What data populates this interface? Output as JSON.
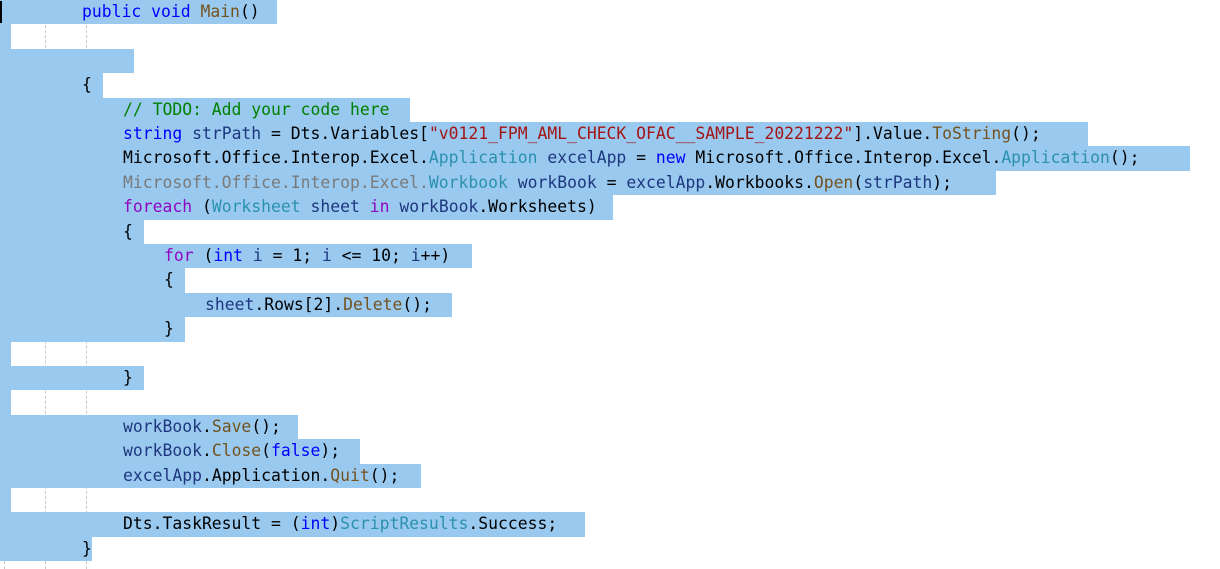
{
  "editor": {
    "language": "C#",
    "selection_color": "#99c9ef",
    "lines": [
      {
        "indent": 2,
        "sel_end_chars": 20,
        "tokens": [
          [
            "kw",
            "public"
          ],
          [
            "pl",
            " "
          ],
          [
            "kw",
            "void"
          ],
          [
            "pl",
            " "
          ],
          [
            "mt",
            "Main"
          ],
          [
            "pl",
            "()"
          ]
        ]
      },
      {
        "indent": 0,
        "sel_end_chars": 1,
        "tokens": []
      },
      {
        "indent": 0,
        "sel_end_chars": 13,
        "tokens": []
      },
      {
        "indent": 2,
        "sel_end_chars": 10,
        "tokens": [
          [
            "pl",
            "{"
          ]
        ]
      },
      {
        "indent": 3,
        "sel_end_chars": 40,
        "tokens": [
          [
            "cm",
            "// TODO: Add your code here"
          ]
        ]
      },
      {
        "indent": 3,
        "sel_end_chars": 106,
        "tokens": [
          [
            "kw",
            "string"
          ],
          [
            "pl",
            " "
          ],
          [
            "lv",
            "strPath"
          ],
          [
            "pl",
            " = Dts.Variables["
          ],
          [
            "st",
            "\"v0121_FPM_AML_CHECK_OFAC__SAMPLE_20221222\""
          ],
          [
            "pl",
            "].Value."
          ],
          [
            "mt",
            "ToString"
          ],
          [
            "pl",
            "();"
          ]
        ]
      },
      {
        "indent": 3,
        "sel_end_chars": 116,
        "tokens": [
          [
            "pl",
            "Microsoft.Office.Interop.Excel."
          ],
          [
            "ty",
            "Application"
          ],
          [
            "pl",
            " "
          ],
          [
            "lv",
            "excelApp"
          ],
          [
            "pl",
            " = "
          ],
          [
            "kw",
            "new"
          ],
          [
            "pl",
            " Microsoft.Office.Interop.Excel."
          ],
          [
            "ty",
            "Application"
          ],
          [
            "pl",
            "();"
          ]
        ]
      },
      {
        "indent": 3,
        "sel_end_chars": 97,
        "tokens": [
          [
            "gr",
            "Microsoft.Office.Interop.Excel."
          ],
          [
            "ty",
            "Workbook"
          ],
          [
            "pl",
            " "
          ],
          [
            "lv",
            "workBook"
          ],
          [
            "pl",
            " = "
          ],
          [
            "lv",
            "excelApp"
          ],
          [
            "pl",
            ".Workbooks."
          ],
          [
            "mt",
            "Open"
          ],
          [
            "pl",
            "("
          ],
          [
            "lv",
            "strPath"
          ],
          [
            "pl",
            ");"
          ]
        ]
      },
      {
        "indent": 3,
        "sel_end_chars": 60,
        "tokens": [
          [
            "ctl",
            "foreach"
          ],
          [
            "pl",
            " ("
          ],
          [
            "ty",
            "Worksheet"
          ],
          [
            "pl",
            " "
          ],
          [
            "lv",
            "sheet"
          ],
          [
            "pl",
            " "
          ],
          [
            "ctl",
            "in"
          ],
          [
            "pl",
            " "
          ],
          [
            "lv",
            "workBook"
          ],
          [
            "pl",
            ".Worksheets)"
          ]
        ]
      },
      {
        "indent": 3,
        "sel_end_chars": 14,
        "tokens": [
          [
            "pl",
            "{"
          ]
        ]
      },
      {
        "indent": 4,
        "sel_end_chars": 46,
        "tokens": [
          [
            "ctl",
            "for"
          ],
          [
            "pl",
            " ("
          ],
          [
            "kw",
            "int"
          ],
          [
            "pl",
            " "
          ],
          [
            "lv",
            "i"
          ],
          [
            "pl",
            " = 1; "
          ],
          [
            "lv",
            "i"
          ],
          [
            "pl",
            " <= 10; "
          ],
          [
            "lv",
            "i"
          ],
          [
            "pl",
            "++)"
          ]
        ]
      },
      {
        "indent": 4,
        "sel_end_chars": 18,
        "tokens": [
          [
            "pl",
            "{"
          ]
        ]
      },
      {
        "indent": 5,
        "sel_end_chars": 44,
        "tokens": [
          [
            "lv",
            "sheet"
          ],
          [
            "pl",
            ".Rows[2]."
          ],
          [
            "mt",
            "Delete"
          ],
          [
            "pl",
            "();"
          ]
        ]
      },
      {
        "indent": 4,
        "sel_end_chars": 18,
        "tokens": [
          [
            "pl",
            "}"
          ]
        ]
      },
      {
        "indent": 0,
        "sel_end_chars": 1,
        "tokens": []
      },
      {
        "indent": 3,
        "sel_end_chars": 14,
        "tokens": [
          [
            "pl",
            "}"
          ]
        ]
      },
      {
        "indent": 0,
        "sel_end_chars": 1,
        "tokens": []
      },
      {
        "indent": 3,
        "sel_end_chars": 29,
        "tokens": [
          [
            "lv",
            "workBook"
          ],
          [
            "pl",
            "."
          ],
          [
            "mt",
            "Save"
          ],
          [
            "pl",
            "();"
          ]
        ]
      },
      {
        "indent": 3,
        "sel_end_chars": 35,
        "tokens": [
          [
            "lv",
            "workBook"
          ],
          [
            "pl",
            "."
          ],
          [
            "mt",
            "Close"
          ],
          [
            "pl",
            "("
          ],
          [
            "kw",
            "false"
          ],
          [
            "pl",
            ");"
          ]
        ]
      },
      {
        "indent": 3,
        "sel_end_chars": 41,
        "tokens": [
          [
            "lv",
            "excelApp"
          ],
          [
            "pl",
            ".Application."
          ],
          [
            "mt",
            "Quit"
          ],
          [
            "pl",
            "();"
          ]
        ]
      },
      {
        "indent": 0,
        "sel_end_chars": 1,
        "tokens": []
      },
      {
        "indent": 3,
        "sel_end_chars": 57,
        "tokens": [
          [
            "pl",
            "Dts.TaskResult = ("
          ],
          [
            "kw",
            "int"
          ],
          [
            "pl",
            ")"
          ],
          [
            "ty",
            "ScriptResults"
          ],
          [
            "pl",
            ".Success;"
          ]
        ]
      },
      {
        "indent": 2,
        "sel_end_chars": 9,
        "tokens": [
          [
            "pl",
            "}"
          ]
        ]
      }
    ]
  }
}
